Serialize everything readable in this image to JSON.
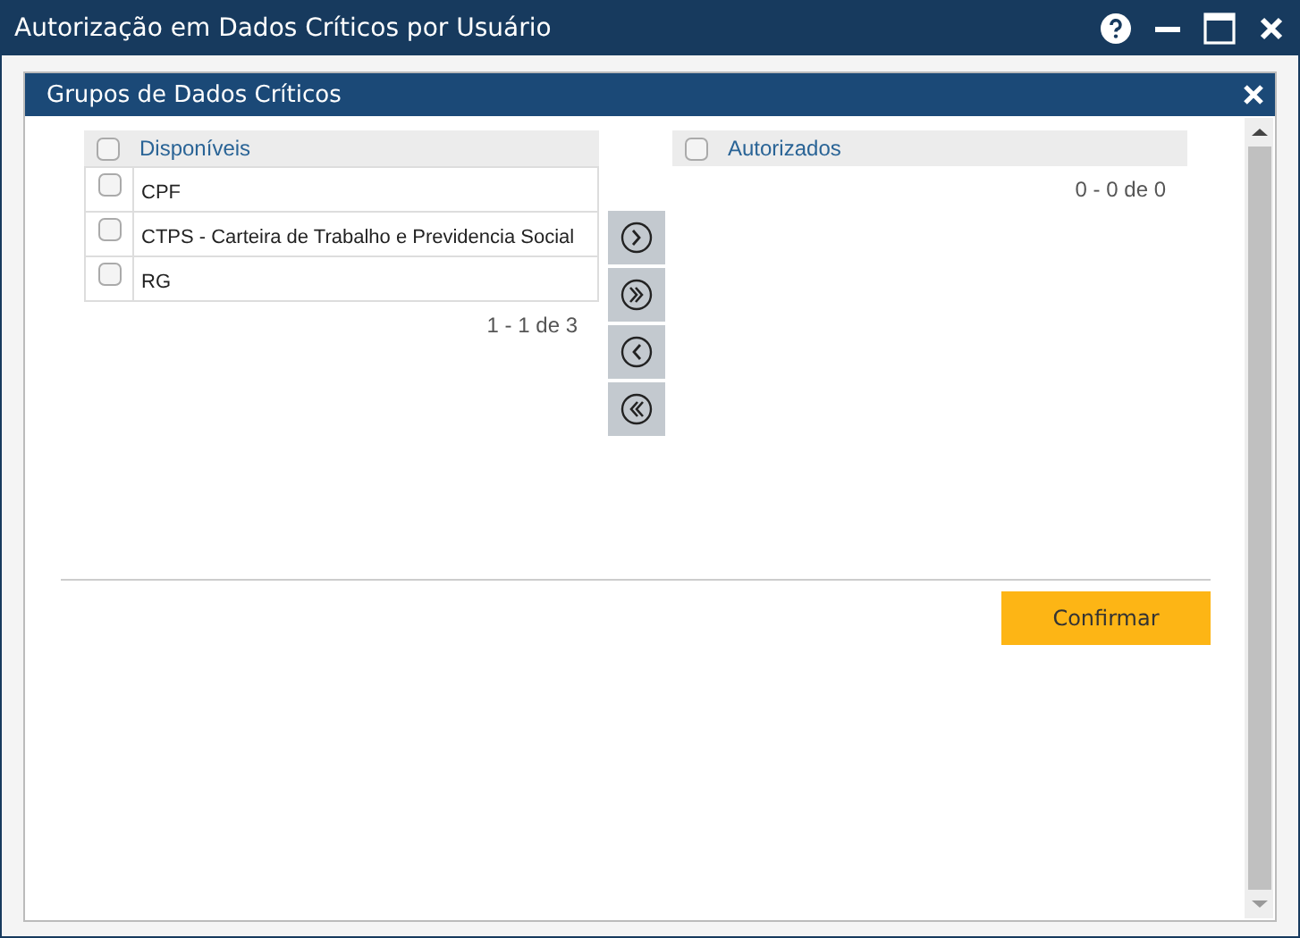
{
  "window": {
    "title": "Autorização em Dados Críticos por Usuário"
  },
  "dialog": {
    "title": "Grupos de Dados Críticos",
    "available": {
      "header": "Disponíveis",
      "all_checked": false,
      "items": [
        {
          "label": "CPF",
          "checked": false
        },
        {
          "label": "CTPS - Carteira de Trabalho e Previdencia Social",
          "checked": false
        },
        {
          "label": "RG",
          "checked": false
        }
      ],
      "pager": "1 - 1 de 3"
    },
    "authorized": {
      "header": "Autorizados",
      "all_checked": false,
      "pager": "0 - 0 de 0"
    },
    "confirm_button": "Confirmar"
  }
}
